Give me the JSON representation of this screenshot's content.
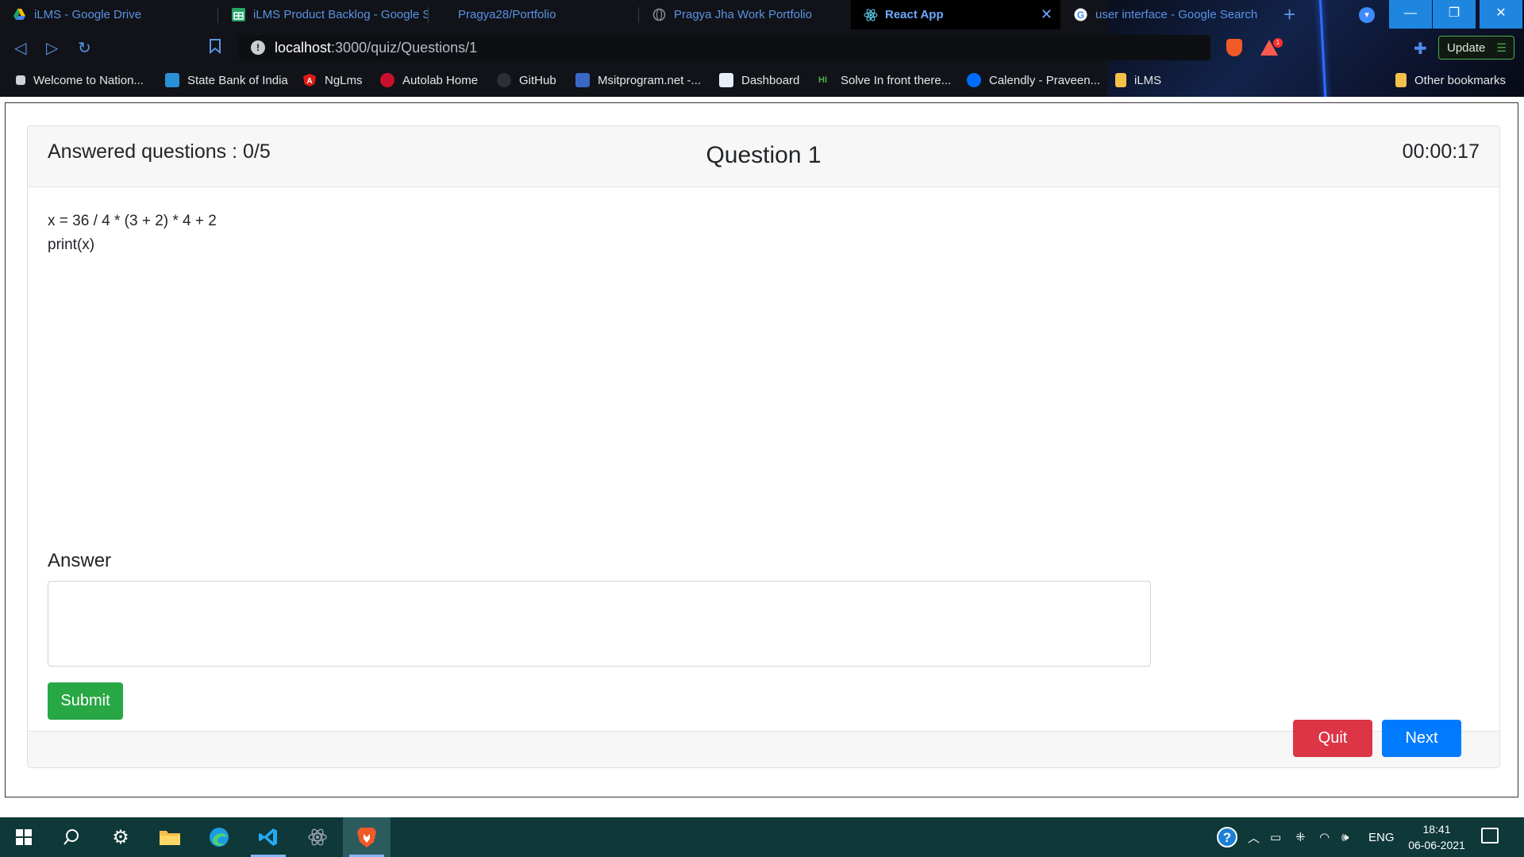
{
  "browser": {
    "tabs": [
      {
        "title": "iLMS - Google Drive",
        "icon": "google-drive-icon",
        "active": false
      },
      {
        "title": "iLMS Product Backlog - Google S",
        "icon": "google-sheets-icon",
        "active": false
      },
      {
        "title": "Pragya28/Portfolio",
        "icon": "",
        "active": false
      },
      {
        "title": "Pragya Jha Work Portfolio",
        "icon": "globe-icon",
        "active": false
      },
      {
        "title": "React App",
        "icon": "react-icon",
        "active": true
      },
      {
        "title": "user interface - Google Search",
        "icon": "google-icon",
        "active": false
      }
    ],
    "url": {
      "host": "localhost",
      "path": ":3000/quiz/Questions/1"
    },
    "update_label": "Update",
    "rewards_badge": "1",
    "bookmarks": [
      {
        "label": "Welcome to Nation...",
        "icon": "nation-icon"
      },
      {
        "label": "State Bank of India",
        "icon": "sbi-icon"
      },
      {
        "label": "NgLms",
        "icon": "angular-icon"
      },
      {
        "label": "Autolab Home",
        "icon": "autolab-icon"
      },
      {
        "label": "GitHub",
        "icon": "github-icon"
      },
      {
        "label": "Msitprogram.net -...",
        "icon": "msit-icon"
      },
      {
        "label": "Dashboard",
        "icon": "dashboard-icon"
      },
      {
        "label": "Solve In front there...",
        "icon": "solve-icon"
      },
      {
        "label": "Calendly - Praveen...",
        "icon": "calendly-icon"
      },
      {
        "label": "iLMS",
        "icon": "folder-icon"
      }
    ],
    "other_bookmarks": "Other bookmarks"
  },
  "quiz": {
    "answered_label": "Answered questions : 0/5",
    "question_title": "Question 1",
    "timer": "00:00:17",
    "question_lines": [
      "x = 36 / 4 * (3 + 2) * 4 + 2",
      "print(x)"
    ],
    "answer_label": "Answer",
    "answer_value": "",
    "submit_label": "Submit",
    "quit_label": "Quit",
    "next_label": "Next"
  },
  "taskbar": {
    "language": "ENG",
    "time": "18:41",
    "date": "06-06-2021"
  },
  "colors": {
    "submit": "#28a745",
    "quit": "#dc3545",
    "next": "#007bff",
    "taskbar": "#0f3838"
  }
}
